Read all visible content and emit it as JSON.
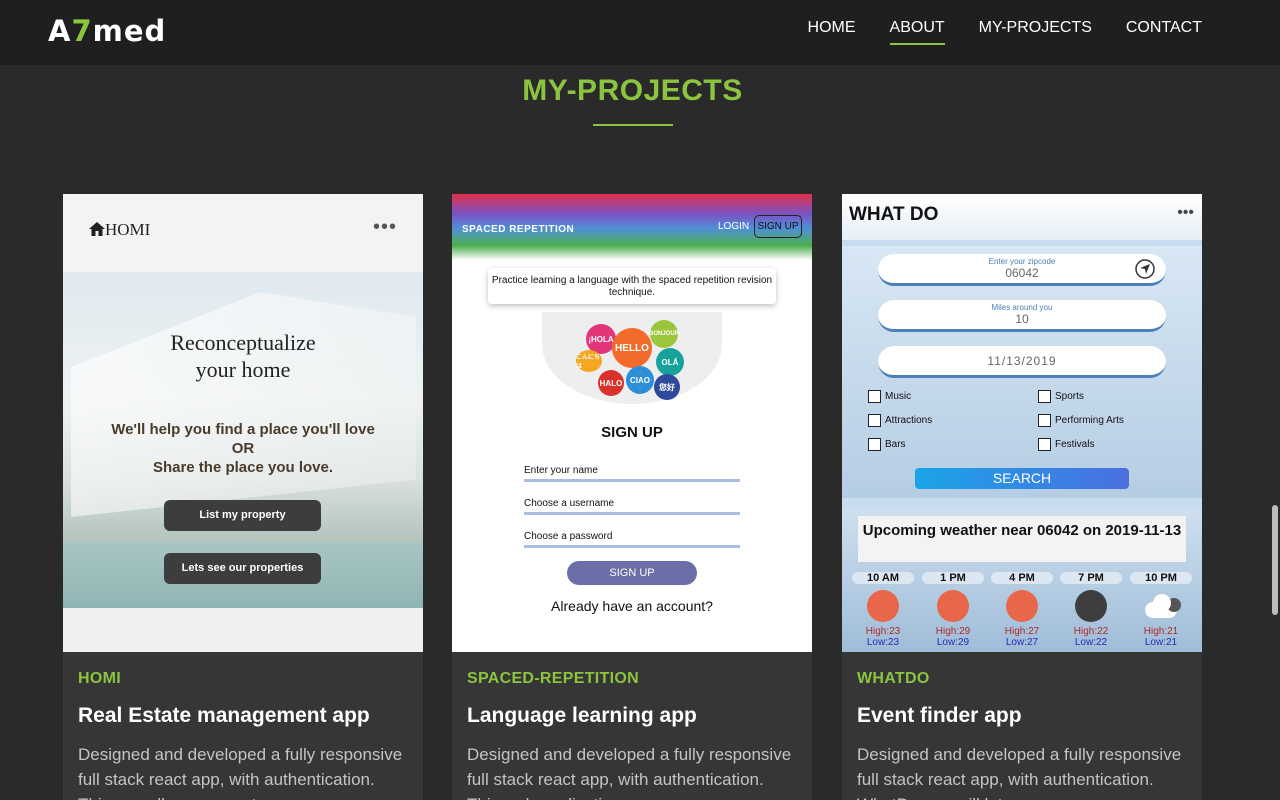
{
  "nav": {
    "logo_pre": "A",
    "logo_accent": "7",
    "logo_post": "med",
    "links": [
      "HOME",
      "ABOUT",
      "MY-PROJECTS",
      "CONTACT"
    ],
    "active": "ABOUT"
  },
  "section": {
    "title": "MY-PROJECTS"
  },
  "colors": {
    "accent": "#8bc53f",
    "background": "#2a2a2a",
    "card": "#363636"
  },
  "projects": [
    {
      "tag": "HOMI",
      "title": "Real Estate management app",
      "desc": "Designed and developed a fully responsive full stack react app, with authentication. This app allows a user to",
      "shot": {
        "brand": "HOMI",
        "menu": "•••",
        "headline_1": "Reconceptualize",
        "headline_2": "your home",
        "sub_1": "We'll help you find a place you'll love",
        "sub_2": "OR",
        "sub_3": "Share the place you love.",
        "btn_1": "List my property",
        "btn_2": "Lets see our properties"
      }
    },
    {
      "tag": "SPACED-REPETITION",
      "title": "Language learning app",
      "desc": "Designed and developed a fully responsive full stack react app, with authentication. This web application uses",
      "shot": {
        "brand": "SPACED REPETITION",
        "login": "LOGIN",
        "signup": "SIGN UP",
        "quote": "Practice learning a language with the spaced repetition revision technique.",
        "bubbles": [
          "¡HOLA",
          "HELLO",
          "BONJOUR",
          "OLÁ",
          "CIAO",
          "HALO",
          "こんにちは",
          "您好"
        ],
        "heading": "SIGN UP",
        "field_name": "Enter your name",
        "field_user": "Choose a username",
        "field_pass": "Choose a password",
        "submit": "SIGN UP",
        "already": "Already have an account?"
      }
    },
    {
      "tag": "WHATDO",
      "title": "Event finder app",
      "desc": "Designed and developed a fully responsive full stack react app, with authentication. WhatDo app will let you",
      "shot": {
        "brand": "WHAT DO",
        "menu": "•••",
        "zip_label": "Enter your zipcode",
        "zip_value": "06042",
        "miles_label": "Miles around you",
        "miles_value": "10",
        "date_value": "11/13/2019",
        "categories": [
          "Music",
          "Sports",
          "Attractions",
          "Performing Arts",
          "Bars",
          "Festivals"
        ],
        "search": "SEARCH",
        "weather_title": "Upcoming weather near 06042 on 2019-11-13",
        "forecast": [
          {
            "time": "10 AM",
            "icon": "sun-icon",
            "high": "High:23",
            "low": "Low:23"
          },
          {
            "time": "1 PM",
            "icon": "sun-icon",
            "high": "High:29",
            "low": "Low:29"
          },
          {
            "time": "4 PM",
            "icon": "sun-icon",
            "high": "High:27",
            "low": "Low:27"
          },
          {
            "time": "7 PM",
            "icon": "moon-icon",
            "high": "High:22",
            "low": "Low:22"
          },
          {
            "time": "10 PM",
            "icon": "cloud-icon",
            "high": "High:21",
            "low": "Low:21"
          }
        ]
      }
    }
  ]
}
